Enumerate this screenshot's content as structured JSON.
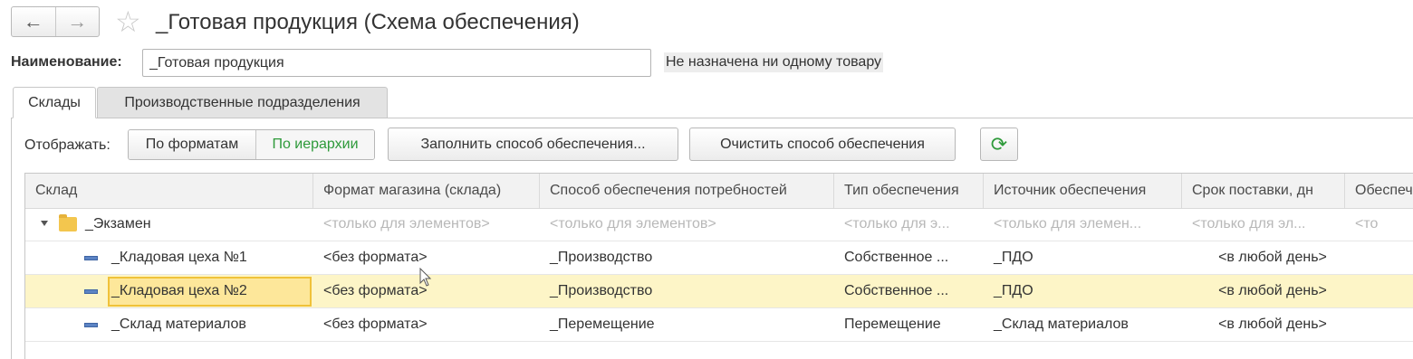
{
  "window": {
    "title": "_Готовая продукция (Схема обеспечения)"
  },
  "nav": {
    "back_icon": "←",
    "forward_icon": "→",
    "star_icon": "☆"
  },
  "form": {
    "name_label": "Наименование:",
    "name_value": "_Готовая продукция",
    "status_text": "Не назначена ни одному товару"
  },
  "tabs": [
    {
      "label": "Склады",
      "active": true
    },
    {
      "label": "Производственные подразделения",
      "active": false
    }
  ],
  "toolbar": {
    "show_label": "Отображать:",
    "view_formats": "По форматам",
    "view_hierarchy": "По иерархии",
    "fill_button": "Заполнить способ обеспечения...",
    "clear_button": "Очистить способ обеспечения",
    "refresh_icon": "⟳"
  },
  "table": {
    "columns": [
      "Склад",
      "Формат магазина (склада)",
      "Способ обеспечения потребностей",
      "Тип обеспечения",
      "Источник обеспечения",
      "Срок поставки, дн",
      "Обеспеч"
    ],
    "group_row": {
      "name": "_Экзамен",
      "cells": [
        "<только для элементов>",
        "<только для элементов>",
        "<только для э...",
        "<только для элемен...",
        "<только для эл...",
        "<то"
      ]
    },
    "rows": [
      {
        "name": "_Кладовая цеха №1",
        "format": "<без формата>",
        "method": "_Производство",
        "type": "Собственное ...",
        "source": "_ПДО",
        "term": "<в любой день>",
        "extra": "",
        "selected": false
      },
      {
        "name": "_Кладовая цеха №2",
        "format": "<без формата>",
        "method": "_Производство",
        "type": "Собственное ...",
        "source": "_ПДО",
        "term": "<в любой день>",
        "extra": "",
        "selected": true
      },
      {
        "name": "_Склад материалов",
        "format": "<без формата>",
        "method": "_Перемещение",
        "type": "Перемещение",
        "source": "_Склад материалов",
        "term": "<в любой день>",
        "extra": "",
        "selected": false
      }
    ]
  },
  "colors": {
    "accent_green": "#2e9a3a",
    "selection": "#fdf5c7",
    "focus": "#f0c23a"
  }
}
